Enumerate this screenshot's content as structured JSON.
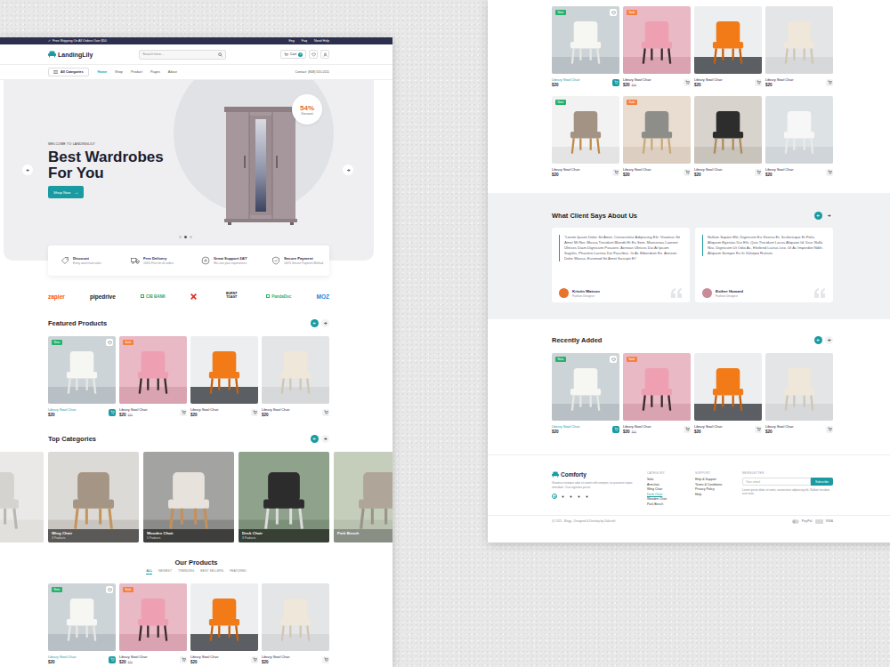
{
  "left_page": {
    "top_bar": {
      "icon": "✓",
      "shipping": "Free Shipping On All Orders Over $50",
      "links": [
        "Eng",
        "Faq",
        "Need Help"
      ]
    },
    "header": {
      "logo": "LandingLily",
      "search_placeholder": "Search here...",
      "cart_label": "Cart",
      "cart_count": "0"
    },
    "nav": {
      "categories_button": "All Categories",
      "items": [
        {
          "label": "Home",
          "selected": true
        },
        {
          "label": "Shop",
          "selected": false
        },
        {
          "label": "Product",
          "selected": false
        },
        {
          "label": "Pages",
          "selected": false
        },
        {
          "label": "About",
          "selected": false
        }
      ],
      "contact": "Contact: (808) 555-0111"
    },
    "hero": {
      "eyebrow": "WELCOME TO LANDINGLILY",
      "title": "Best Wardrobes For You",
      "button": "Shop Now",
      "button_icon": "→",
      "discount_value": "54%",
      "discount_label": "Discount",
      "dots": [
        {
          "selected": false
        },
        {
          "selected": true
        },
        {
          "selected": false
        }
      ]
    },
    "features": [
      {
        "title": "Discount",
        "subtitle": "Every week new sales"
      },
      {
        "title": "Free Delivery",
        "subtitle": "100% Free for all orders"
      },
      {
        "title": "Great Support 24/7",
        "subtitle": "We care your experiences"
      },
      {
        "title": "Secure Payment",
        "subtitle": "100% Secure Payment Method"
      }
    ],
    "brands": [
      {
        "kind": "text",
        "name": "zapier",
        "color": "#ff4f00"
      },
      {
        "kind": "text",
        "name": "pipedrive",
        "color": "#1a1a1a"
      },
      {
        "kind": "icon-text",
        "name": "CIB BANK",
        "color": "#3aa35b"
      },
      {
        "kind": "mark",
        "color": "#e52d27"
      },
      {
        "kind": "text",
        "name": "BURNT TOAST",
        "color": "#1a1a1a"
      },
      {
        "kind": "icon-text",
        "name": "PandaDoc",
        "color": "#25b46a"
      },
      {
        "kind": "text",
        "name": "MOZ",
        "color": "#2d7fd8"
      }
    ],
    "featured": {
      "title": "Featured Products",
      "products": [
        {
          "name": "Library Stool Chair",
          "price": "$20",
          "badge": {
            "label": "New",
            "color": "#27b06e"
          },
          "wishlist": true,
          "highlighted": true
        },
        {
          "name": "Library Stool Chair",
          "price": "$20",
          "old_price": "$30",
          "badge": {
            "label": "Sale",
            "color": "#f5813f"
          },
          "wishlist": false,
          "highlighted": false
        },
        {
          "name": "Library Stool Chair",
          "price": "$20",
          "wishlist": false,
          "highlighted": false
        },
        {
          "name": "Library Stool Chair",
          "price": "$20",
          "wishlist": false,
          "highlighted": false
        }
      ]
    },
    "categories": {
      "title": "Top Categories",
      "items": [
        {
          "name": "Wing Chair",
          "count": "3 Products",
          "faded": false
        },
        {
          "name": "Wooden Chair",
          "count": "5 Products",
          "faded": false
        },
        {
          "name": "Desk Chair",
          "count": "3 Products",
          "faded": false
        },
        {
          "name": "Park Bench",
          "faded": true
        }
      ]
    },
    "our_products": {
      "title": "Our Products",
      "tabs": [
        {
          "label": "ALL",
          "selected": true
        },
        {
          "label": "NEWEST",
          "selected": false
        },
        {
          "label": "TRENDING",
          "selected": false
        },
        {
          "label": "BEST SELLERS",
          "selected": false
        },
        {
          "label": "FEATURED",
          "selected": false
        }
      ],
      "products": [
        {
          "name": "Library Stool Chair",
          "price": "$20",
          "badge": {
            "label": "New",
            "color": "#27b06e"
          },
          "wishlist": true,
          "highlighted": true
        },
        {
          "name": "Library Stool Chair",
          "price": "$20",
          "old_price": "$30",
          "badge": {
            "label": "Sale",
            "color": "#f5813f"
          },
          "wishlist": false,
          "highlighted": false
        },
        {
          "name": "Library Stool Chair",
          "price": "$20",
          "wishlist": false,
          "highlighted": false
        },
        {
          "name": "Library Stool Chair",
          "price": "$20",
          "wishlist": false,
          "highlighted": false
        }
      ]
    }
  },
  "right_page": {
    "products": [
      {
        "name": "Library Stool Chair",
        "price": "$20",
        "badge": {
          "label": "New",
          "color": "#27b06e"
        },
        "wishlist": true,
        "highlighted": true
      },
      {
        "name": "Library Stool Chair",
        "price": "$20",
        "old_price": "$30",
        "badge": {
          "label": "Sale",
          "color": "#f5813f"
        },
        "wishlist": false,
        "highlighted": false
      },
      {
        "name": "Library Stool Chair",
        "price": "$20",
        "wishlist": false,
        "highlighted": false
      },
      {
        "name": "Library Stool Chair",
        "price": "$20",
        "wishlist": false,
        "highlighted": false
      },
      {
        "name": "Library Stool Chair",
        "price": "$20",
        "badge": {
          "label": "New",
          "color": "#27b06e"
        },
        "wishlist": false,
        "highlighted": false
      },
      {
        "name": "Library Stool Chair",
        "price": "$20",
        "badge": {
          "label": "Sale",
          "color": "#f5813f"
        },
        "wishlist": false,
        "highlighted": false
      },
      {
        "name": "Library Stool Chair",
        "price": "$20",
        "wishlist": false,
        "highlighted": false
      },
      {
        "name": "Library Stool Chair",
        "price": "$20",
        "wishlist": false,
        "highlighted": false
      }
    ],
    "testimonials": {
      "title": "What Client Says About Us",
      "items": [
        {
          "quote": "“Lorem Ipsum Dolor Sit Amet, Consectetur Adipiscing Elit. Vivamus Sit Amet Mi Nec Massa Tincidunt Blandit Et Eu Sem. Maecenas Laoreet Ultrices Diam Dignissim Posuere. Aenean Ultrices Dui At Ipsum Sagittis, Pharetra Lacinia Dui Faucibus. In Ac Bibendum Ex. Aenean Dolor Massa, Euismod Sit Amet Suscipit Et”",
          "name": "Kristin Watson",
          "role": "Fashion Designer",
          "color": "#e8732c"
        },
        {
          "quote": "Nullam Sapien Elit, Dignissim Eu Viverra Et, Scelerisque Et Felis. Aliquam Egestas Dui Elit, Quis Tincidunt Lacus Aliquam Id. Duis Nulla Nisi, Dignissim Ut Odio Ac, Eleifend Luctus Leo. Ut Ac Imperdiet Nibh. Aliquam Semper Ex In Volutpat Rutrum.",
          "name": "Esther Howard",
          "role": "Fashion Designer",
          "color": "#c98b9a"
        }
      ]
    },
    "recent": {
      "title": "Recently Added",
      "products": [
        {
          "name": "Library Stool Chair",
          "price": "$20",
          "badge": {
            "label": "New",
            "color": "#27b06e"
          },
          "wishlist": true,
          "highlighted": true
        },
        {
          "name": "Library Stool Chair",
          "price": "$20",
          "old_price": "$30",
          "badge": {
            "label": "Sale",
            "color": "#f5813f"
          },
          "wishlist": false,
          "highlighted": false
        },
        {
          "name": "Library Stool Chair",
          "price": "$20",
          "wishlist": false,
          "highlighted": false
        },
        {
          "name": "Library Stool Chair",
          "price": "$20",
          "wishlist": false,
          "highlighted": false
        }
      ]
    },
    "footer": {
      "logo": "Comforty",
      "description": "Vivamus tristique odio sit amet velit semper, eu posuere turpis interdum. Cras egestas purus",
      "socials": [
        {
          "selected": true
        },
        {
          "selected": false
        },
        {
          "selected": false
        },
        {
          "selected": false
        },
        {
          "selected": false
        }
      ],
      "columns": [
        {
          "title": "CATEGORY",
          "items": [
            {
              "label": "Sofa",
              "selected": false
            },
            {
              "label": "Armchair",
              "selected": false
            },
            {
              "label": "Wing Chair",
              "selected": false
            },
            {
              "label": "Desk Chair",
              "selected": true
            },
            {
              "label": "Wooden Chair",
              "selected": false
            },
            {
              "label": "Park Bench",
              "selected": false
            }
          ]
        },
        {
          "title": "SUPPORT",
          "items": [
            {
              "label": "Help & Support",
              "selected": false
            },
            {
              "label": "Terms & Conditions",
              "selected": false
            },
            {
              "label": "Privacy Policy",
              "selected": false
            },
            {
              "label": "Help",
              "selected": false
            }
          ]
        }
      ],
      "newsletter": {
        "title": "NEWSLETTER",
        "placeholder": "Your email",
        "button": "Subscribe",
        "note": "Lorem ipsum dolor sit amet, consectetur adipiscing elit. Nullam tincidunt erat enim."
      },
      "copyright": "@ 2021 - Blogy - Designed & Develop by Zakirsoft",
      "payments": [
        "PayPal",
        "VISA"
      ]
    }
  }
}
